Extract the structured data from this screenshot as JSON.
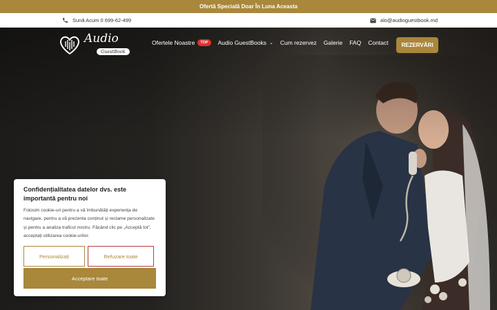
{
  "promo_bar": {
    "text": "Ofertă Specială Doar În Luna Aceasta"
  },
  "contact_bar": {
    "phone_text": "Sună Acum 0 699-62-499",
    "email_text": "alo@audioguestbook.md"
  },
  "logo": {
    "word": "Audio",
    "sub": "GuestBook"
  },
  "nav": {
    "offers": "Ofertele Noastre",
    "offers_badge": "TOP",
    "guestbooks": "Audio GuestBooks",
    "how_to_book": "Cum rezervez",
    "gallery": "Galerie",
    "faq": "FAQ",
    "contact": "Contact",
    "reserve": "REZERVĂRI"
  },
  "cookie": {
    "title": "Confidențialitatea datelor dvs. este importantă pentru noi",
    "body": "Folosim cookie-uri pentru a vă îmbunătăți experiența de navigare, pentru a vă prezenta conținut și reclame personalizate și pentru a analiza traficul nostru. Făcând clic pe „Acceptă tot”, acceptați utilizarea cookie-urilor.",
    "customize": "Personalizați",
    "refuse": "Refuzare toate",
    "accept": "Acceptare toate"
  },
  "colors": {
    "accent": "#a9873b",
    "badge": "#e0312f",
    "refuse_border": "#b33f3f"
  }
}
